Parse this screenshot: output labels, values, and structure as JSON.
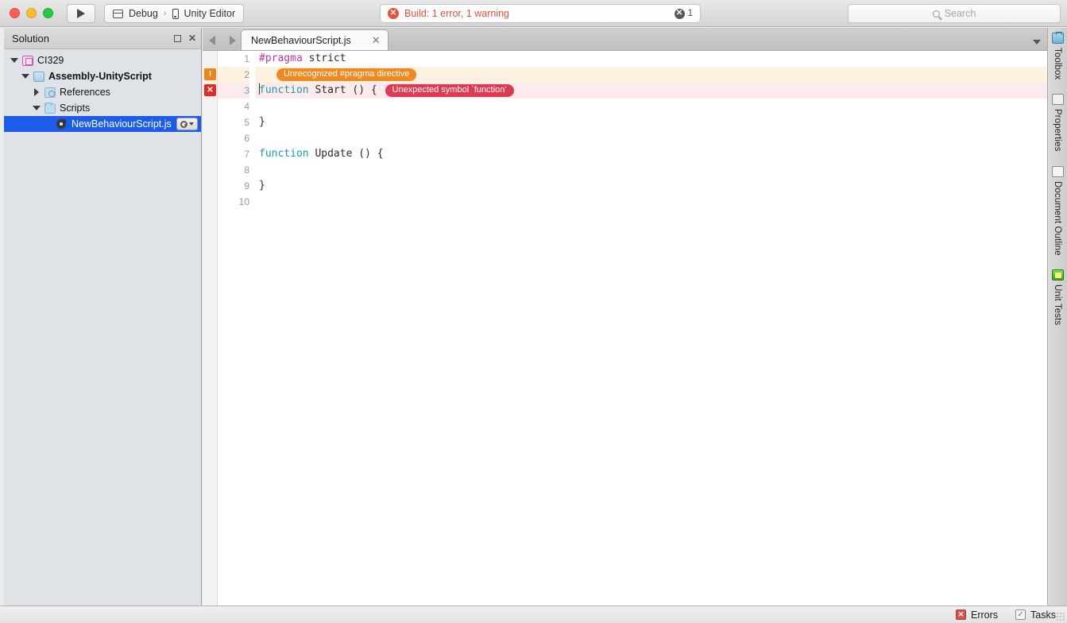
{
  "titlebar": {
    "run_label": "run-button",
    "config": {
      "debug": "Debug",
      "separator": "›",
      "target": "Unity Editor"
    },
    "build_status": {
      "text": "Build: 1 error, 1 warning",
      "error_glyph": "✕",
      "count": "1"
    },
    "search": {
      "placeholder": "Search",
      "value": ""
    }
  },
  "solution": {
    "title": "Solution",
    "pin_label": "□",
    "close_label": "✕",
    "tree": [
      {
        "label": "CI329",
        "icon": "solution-icon",
        "indent": 0,
        "arrow": "down",
        "bold": false,
        "selected": false
      },
      {
        "label": "Assembly-UnityScript",
        "icon": "assembly-icon",
        "indent": 1,
        "arrow": "down",
        "bold": true,
        "selected": false
      },
      {
        "label": "References",
        "icon": "references-icon",
        "indent": 2,
        "arrow": "right",
        "bold": false,
        "selected": false
      },
      {
        "label": "Scripts",
        "icon": "folder-icon",
        "indent": 2,
        "arrow": "down",
        "bold": false,
        "selected": false
      },
      {
        "label": "NewBehaviourScript.js",
        "icon": "javascript-file-icon",
        "indent": 3,
        "arrow": "blank",
        "bold": false,
        "selected": true
      }
    ]
  },
  "editor": {
    "tabs": [
      {
        "label": "NewBehaviourScript.js",
        "close": "✕",
        "active": true
      }
    ],
    "tab_dropdown": "chevron-down-icon",
    "nav_back": "◀",
    "nav_forward": "▶",
    "line_numbers": [
      "1",
      "2",
      "3",
      "4",
      "5",
      "6",
      "7",
      "8",
      "9",
      "10"
    ],
    "lines": [
      {
        "n": "1",
        "kind": "code",
        "tokens": [
          {
            "t": "#pragma",
            "c": "pragma"
          },
          {
            "t": " strict",
            "c": "plain"
          }
        ]
      },
      {
        "n": "2",
        "kind": "warn",
        "tokens": [],
        "bubble": "Unrecognized #pragma directive",
        "gutter": "warning-marker"
      },
      {
        "n": "3",
        "kind": "err",
        "tokens": [
          {
            "t": "function",
            "c": "func"
          },
          {
            "t": " Start () { ",
            "c": "plain"
          }
        ],
        "bubble": "Unexpected symbol `function'",
        "gutter": "error-marker",
        "caret": true
      },
      {
        "n": "4",
        "kind": "code",
        "tokens": []
      },
      {
        "n": "5",
        "kind": "code",
        "tokens": [
          {
            "t": "}",
            "c": "plain"
          }
        ]
      },
      {
        "n": "6",
        "kind": "code",
        "tokens": []
      },
      {
        "n": "7",
        "kind": "code",
        "tokens": [
          {
            "t": "function",
            "c": "func"
          },
          {
            "t": " Update () {",
            "c": "plain"
          }
        ]
      },
      {
        "n": "8",
        "kind": "code",
        "tokens": []
      },
      {
        "n": "9",
        "kind": "code",
        "tokens": [
          {
            "t": "}",
            "c": "plain"
          }
        ]
      },
      {
        "n": "10",
        "kind": "code",
        "tokens": []
      }
    ]
  },
  "right_dock": {
    "tabs": [
      {
        "label": "Toolbox",
        "icon": "toolbox-icon"
      },
      {
        "label": "Properties",
        "icon": "properties-icon"
      },
      {
        "label": "Document Outline",
        "icon": "document-outline-icon"
      },
      {
        "label": "Unit Tests",
        "icon": "unit-tests-icon"
      }
    ]
  },
  "statusbar": {
    "errors": {
      "label": "Errors",
      "glyph": "✕"
    },
    "tasks": {
      "label": "Tasks",
      "glyph": "✓"
    }
  },
  "colors": {
    "accent_selection": "#1c5ce8",
    "error_red": "#dd3b52",
    "warning_orange": "#ef8a22",
    "keyword_pragma": "#c0399e",
    "keyword_function": "#1b9aa5"
  }
}
